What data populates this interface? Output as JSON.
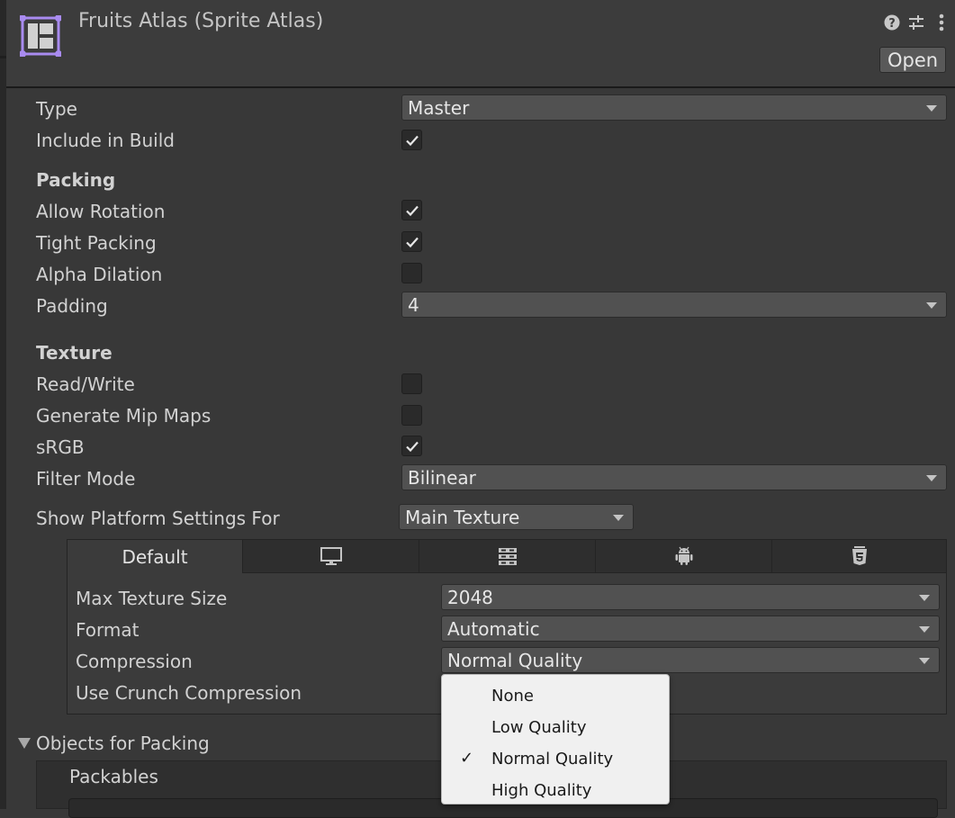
{
  "header": {
    "title": "Fruits Atlas (Sprite Atlas)",
    "open_label": "Open",
    "icons": [
      "help-icon",
      "settings-sliders-icon",
      "more-vert-icon"
    ]
  },
  "fields": {
    "type": {
      "label": "Type",
      "value": "Master"
    },
    "include_in_build": {
      "label": "Include in Build",
      "checked": true
    }
  },
  "packing": {
    "heading": "Packing",
    "allow_rotation": {
      "label": "Allow Rotation",
      "checked": true
    },
    "tight_packing": {
      "label": "Tight Packing",
      "checked": true
    },
    "alpha_dilation": {
      "label": "Alpha Dilation",
      "checked": false
    },
    "padding": {
      "label": "Padding",
      "value": "4"
    }
  },
  "texture": {
    "heading": "Texture",
    "read_write": {
      "label": "Read/Write",
      "checked": false
    },
    "generate_mip_maps": {
      "label": "Generate Mip Maps",
      "checked": false
    },
    "srgb": {
      "label": "sRGB",
      "checked": true
    },
    "filter_mode": {
      "label": "Filter Mode",
      "value": "Bilinear"
    }
  },
  "platform": {
    "show_label": "Show Platform Settings For",
    "show_value": "Main Texture",
    "tabs": [
      {
        "label": "Default",
        "icon": ""
      },
      {
        "label": "",
        "icon": "monitor-icon"
      },
      {
        "label": "",
        "icon": "server-icon"
      },
      {
        "label": "",
        "icon": "android-icon"
      },
      {
        "label": "",
        "icon": "html5-icon"
      }
    ],
    "max_texture_size": {
      "label": "Max Texture Size",
      "value": "2048"
    },
    "format": {
      "label": "Format",
      "value": "Automatic"
    },
    "compression": {
      "label": "Compression",
      "value": "Normal Quality"
    },
    "use_crunch": {
      "label": "Use Crunch Compression"
    }
  },
  "objects": {
    "heading": "Objects for Packing",
    "packables_label": "Packables"
  },
  "compression_popup": {
    "options": [
      "None",
      "Low Quality",
      "Normal Quality",
      "High Quality"
    ],
    "selected": "Normal Quality"
  },
  "colors": {
    "background": "#383838",
    "accent_icon": "#a98bf0",
    "popup_bg": "#f0f0f0"
  }
}
